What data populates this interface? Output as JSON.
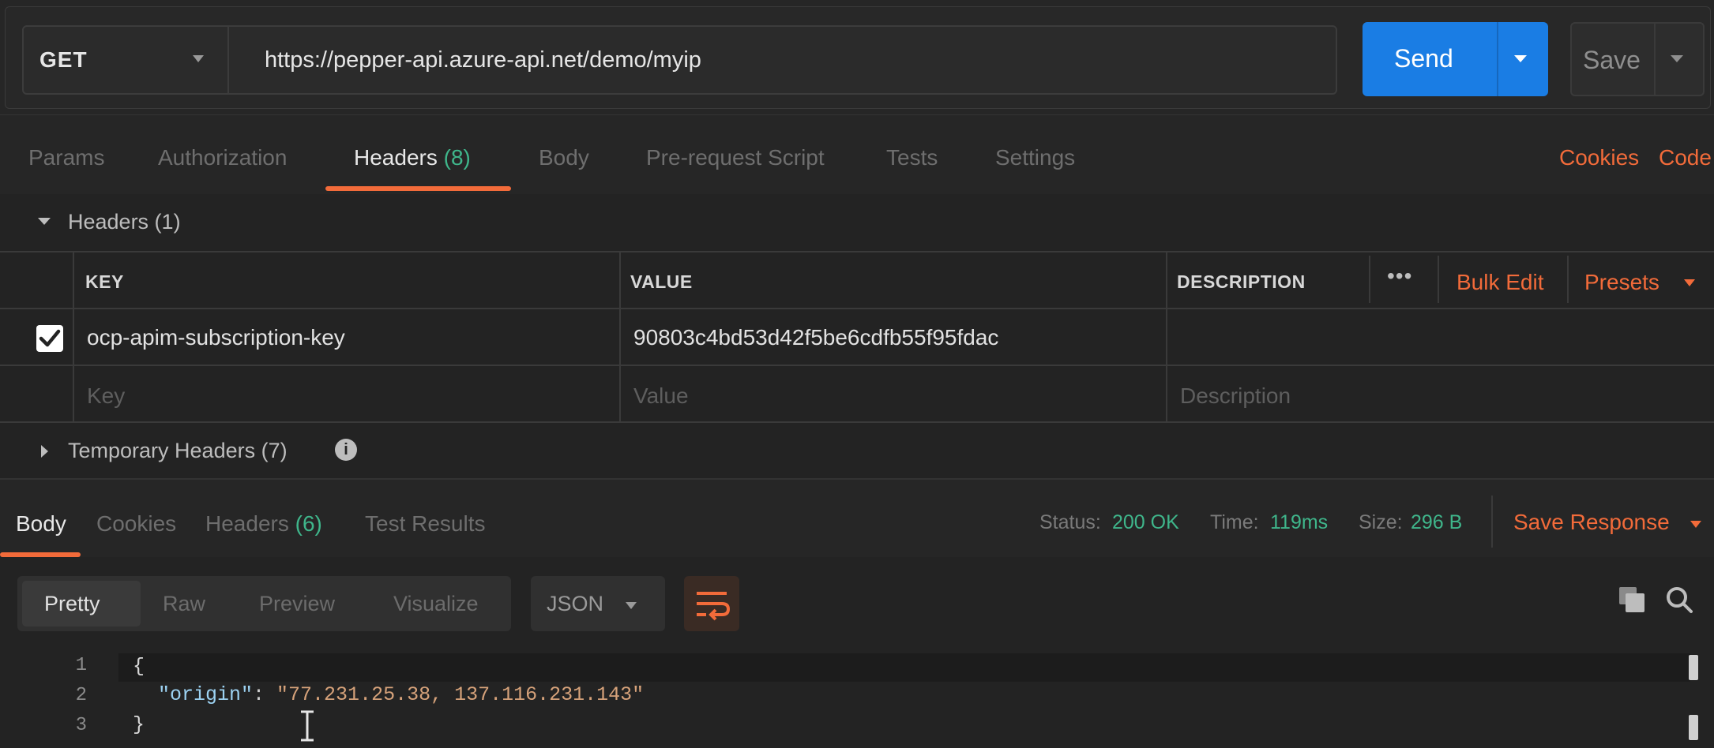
{
  "request": {
    "method": "GET",
    "url": "https://pepper-api.azure-api.net/demo/myip",
    "send_label": "Send",
    "save_label": "Save"
  },
  "request_tabs": [
    {
      "label": "Params"
    },
    {
      "label": "Authorization"
    },
    {
      "label": "Headers",
      "count": "(8)"
    },
    {
      "label": "Body"
    },
    {
      "label": "Pre-request Script"
    },
    {
      "label": "Tests"
    },
    {
      "label": "Settings"
    }
  ],
  "request_links": {
    "cookies": "Cookies",
    "code": "Code"
  },
  "headers_section": {
    "title": "Headers (1)",
    "columns": {
      "key": "KEY",
      "value": "VALUE",
      "description": "DESCRIPTION"
    },
    "more_label": "•••",
    "bulk_edit": "Bulk Edit",
    "presets": "Presets",
    "rows": [
      {
        "checked": true,
        "key": "ocp-apim-subscription-key",
        "value": "90803c4bd53d42f5be6cdfb55f95fdac",
        "description": ""
      }
    ],
    "placeholders": {
      "key": "Key",
      "value": "Value",
      "description": "Description"
    },
    "temporary_title": "Temporary Headers (7)"
  },
  "response_tabs": [
    {
      "label": "Body"
    },
    {
      "label": "Cookies"
    },
    {
      "label": "Headers",
      "count": "(6)"
    },
    {
      "label": "Test Results"
    }
  ],
  "response_status": {
    "status_label": "Status:",
    "status_value": "200 OK",
    "time_label": "Time:",
    "time_value": "119ms",
    "size_label": "Size:",
    "size_value": "296 B",
    "save_response": "Save Response"
  },
  "view_modes": [
    "Pretty",
    "Raw",
    "Preview",
    "Visualize"
  ],
  "format": "JSON",
  "code_lines": [
    {
      "n": "1",
      "open": "{"
    },
    {
      "n": "2",
      "key": "\"origin\"",
      "colon": ": ",
      "value": "\"77.231.25.38, 137.116.231.143\""
    },
    {
      "n": "3",
      "close": "}"
    }
  ],
  "colors": {
    "accent_orange": "#f26b3a",
    "send_blue": "#1a7de4",
    "count_green": "#3fb68b",
    "background": "#232323"
  }
}
